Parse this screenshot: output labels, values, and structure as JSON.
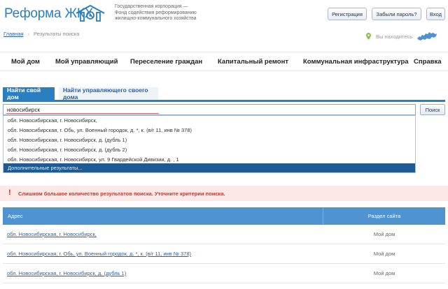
{
  "header": {
    "logo_text": "Реформа ЖКХ",
    "corp_text": "Государственная корпорация —\nФонд содействия реформированию\nжилищно-коммунального хозяйства",
    "register_label": "Регистрация",
    "forgot_label": "Забыли пароль?",
    "login_label": "Вход",
    "brand_color": "#2b7fc0"
  },
  "breadcrumb": {
    "home": "Главная",
    "current": "Результаты поиска"
  },
  "location": {
    "label": "Вы находитесь"
  },
  "nav": {
    "items": [
      "Мой дом",
      "Мой управляющий",
      "Переселение граждан",
      "Капитальный ремонт",
      "Коммунальная инфраструктура",
      "Справка"
    ]
  },
  "search": {
    "tab_active": "Найти свой дом",
    "tab_other": "Найти управляющего своего дома",
    "query": "новосибирск",
    "button_label": "Поиск",
    "suggestions": [
      "обл. Новосибирская, г. Новосибирск,",
      "обл. Новосибирская, г. Обь, ул. Военный городок, д. *, к. (в/г 11, инв № 378)",
      "обл. Новосибирская, г. Новосибирск, д. (дубль 1)",
      "обл. Новосибирская, г. Новосибирск, д. (дубль 2)",
      "обл. Новосибирская, г. Новосибирск, ул. 9 Гвардейской Дивизии, д. , 1"
    ],
    "more_results": "Дополнительные результаты..."
  },
  "warning": {
    "icon": "!",
    "text": "Слишком большое количество результатов поиска. Уточните критерии поиска."
  },
  "results": {
    "col_address": "Адрес",
    "col_section": "Раздел сайта",
    "rows": [
      {
        "address": "обл. Новосибирская, г. Новосибирск,",
        "section": "Мой дом"
      },
      {
        "address": "обл. Новосибирская, г. Обь, ул. Военный городок, д. *, к. (в/г 11, инв № 378)",
        "section": "Мой дом"
      },
      {
        "address": "обл. Новосибирская, г. Новосибирск, д. (дубль 1)",
        "section": "Мой дом"
      }
    ]
  }
}
